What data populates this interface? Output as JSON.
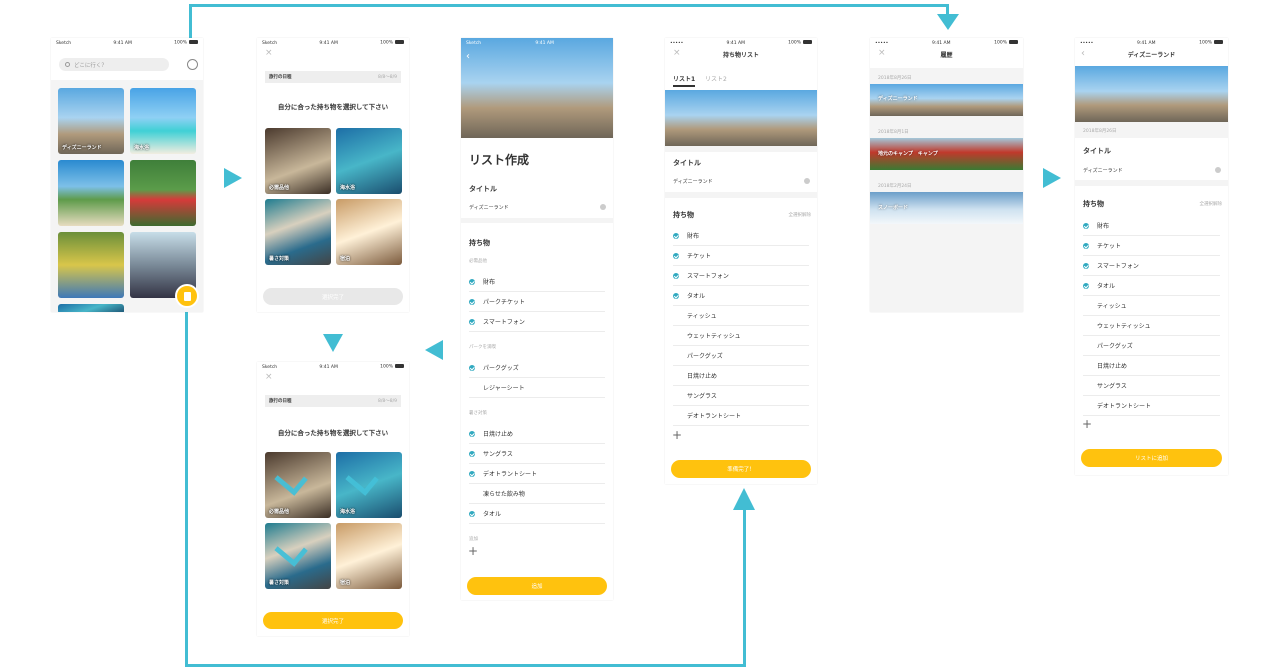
{
  "status": {
    "carrier": "Sketch",
    "time": "9:41 AM",
    "battery": "100%",
    "dots": "•••••"
  },
  "home": {
    "search_placeholder": "どこに行く？",
    "tiles": [
      "ディズニーランド",
      "海水浴",
      "",
      "",
      "",
      ""
    ]
  },
  "select": {
    "date_label": "旅行の日程",
    "date_value": "8/8〜8/9",
    "heading": "自分に合った持ち物を選択して下さい",
    "tiles": [
      "必需品他",
      "海水浴",
      "暑さ対策",
      "宿泊"
    ],
    "button": "選択完了"
  },
  "create": {
    "heading": "リスト作成",
    "title_label": "タイトル",
    "title_value": "ディズニーランド",
    "items_label": "持ち物",
    "sections": [
      {
        "name": "必需品他",
        "items": [
          {
            "label": "財布",
            "checked": true
          },
          {
            "label": "パークチケット",
            "checked": true
          },
          {
            "label": "スマートフォン",
            "checked": true
          }
        ]
      },
      {
        "name": "パークを満喫",
        "items": [
          {
            "label": "パークグッズ",
            "checked": true
          },
          {
            "label": "レジャーシート",
            "checked": false
          }
        ]
      },
      {
        "name": "暑さ対策",
        "items": [
          {
            "label": "日焼け止め",
            "checked": true
          },
          {
            "label": "サングラス",
            "checked": true
          },
          {
            "label": "デオトラントシート",
            "checked": true
          },
          {
            "label": "凍らせた飲み物",
            "checked": false
          },
          {
            "label": "タオル",
            "checked": true
          }
        ]
      }
    ],
    "add_label": "追加",
    "button": "追加"
  },
  "list": {
    "nav_title": "持ち物リスト",
    "tabs": [
      "リスト1",
      "リスト2"
    ],
    "title_label": "タイトル",
    "title_value": "ディズニーランド",
    "items_label": "持ち物",
    "items_action": "全選択解除",
    "items": [
      {
        "label": "財布",
        "checked": true
      },
      {
        "label": "チケット",
        "checked": true
      },
      {
        "label": "スマートフォン",
        "checked": true
      },
      {
        "label": "タオル",
        "checked": true
      },
      {
        "label": "ティッシュ",
        "checked": false
      },
      {
        "label": "ウェットティッシュ",
        "checked": false
      },
      {
        "label": "パークグッズ",
        "checked": false
      },
      {
        "label": "日焼け止め",
        "checked": false
      },
      {
        "label": "サングラス",
        "checked": false
      },
      {
        "label": "デオトラントシート",
        "checked": false
      }
    ],
    "button": "準備完了！"
  },
  "history": {
    "nav_title": "履歴",
    "entries": [
      {
        "date": "2018年8月26日",
        "name": "ディズニーランド"
      },
      {
        "date": "2018年8月1日",
        "name": "地元のキャンプ　キャンプ"
      },
      {
        "date": "2018年2月24日",
        "name": "スノーボード"
      }
    ]
  },
  "detail": {
    "nav_title": "ディズニーランド",
    "date": "2018年8月26日",
    "title_label": "タイトル",
    "title_value": "ディズニーランド",
    "items_label": "持ち物",
    "items_action": "全選択解除",
    "items": [
      {
        "label": "財布",
        "checked": true
      },
      {
        "label": "チケット",
        "checked": true
      },
      {
        "label": "スマートフォン",
        "checked": true
      },
      {
        "label": "タオル",
        "checked": true
      },
      {
        "label": "ティッシュ",
        "checked": false
      },
      {
        "label": "ウェットティッシュ",
        "checked": false
      },
      {
        "label": "パークグッズ",
        "checked": false
      },
      {
        "label": "日焼け止め",
        "checked": false
      },
      {
        "label": "サングラス",
        "checked": false
      },
      {
        "label": "デオトラントシート",
        "checked": false
      }
    ],
    "button": "リストに追加"
  },
  "colors": {
    "accent": "#ffc20e",
    "flow": "#42bdd3",
    "check": "#30a9c0"
  }
}
